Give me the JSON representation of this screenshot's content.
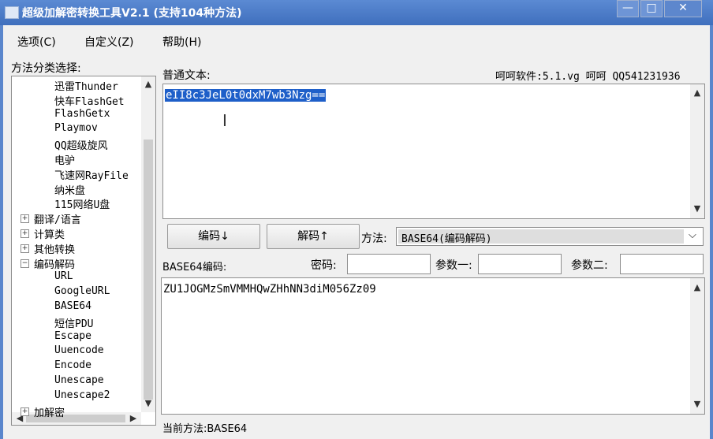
{
  "window": {
    "title": "超级加解密转换工具V2.1 (支持104种方法)",
    "minimize_glyph": "—",
    "maximize_glyph": "□",
    "close_glyph": "✕"
  },
  "menu": [
    "选项(C)",
    "自定义(Z)",
    "帮助(H)"
  ],
  "tree": {
    "label": "方法分类选择:",
    "items": [
      {
        "text": "迅雷Thunder",
        "level": 2
      },
      {
        "text": "快车FlashGet",
        "level": 2
      },
      {
        "text": "FlashGetx",
        "level": 2
      },
      {
        "text": "Playmov",
        "level": 2
      },
      {
        "text": "QQ超级旋风",
        "level": 2
      },
      {
        "text": "电驴",
        "level": 2
      },
      {
        "text": "飞速网RayFile",
        "level": 2
      },
      {
        "text": "纳米盘",
        "level": 2
      },
      {
        "text": "115网络U盘",
        "level": 2
      },
      {
        "text": "翻译/语言",
        "level": 1,
        "toggle": "+"
      },
      {
        "text": "计算类",
        "level": 1,
        "toggle": "+"
      },
      {
        "text": "其他转换",
        "level": 1,
        "toggle": "+"
      },
      {
        "text": "编码解码",
        "level": 1,
        "toggle": "−"
      },
      {
        "text": "URL",
        "level": 2
      },
      {
        "text": "GoogleURL",
        "level": 2
      },
      {
        "text": "BASE64",
        "level": 2
      },
      {
        "text": "短信PDU",
        "level": 2
      },
      {
        "text": "Escape",
        "level": 2
      },
      {
        "text": "Uuencode",
        "level": 2
      },
      {
        "text": "Encode",
        "level": 2
      },
      {
        "text": "Unescape",
        "level": 2
      },
      {
        "text": "Unescape2",
        "level": 2
      },
      {
        "text": "加解密",
        "level": 1,
        "toggle": "+"
      }
    ]
  },
  "plain": {
    "label": "普通文本:",
    "credit": "呵呵软件:5.1.vg  呵呵 QQ541231936",
    "value": "eII8c3JeL0t0dxM7wb3Nzg=="
  },
  "encode_button": "编码↓",
  "decode_button": "解码↑",
  "method": {
    "label": "方法:",
    "value": "BASE64(编码解码)"
  },
  "encoded": {
    "label": "BASE64编码:",
    "value": "ZU1JOGMzSmVMMHQwZHhNN3diM056Zz09"
  },
  "password": {
    "label": "密码:",
    "value": ""
  },
  "param1": {
    "label": "参数一:",
    "value": ""
  },
  "param2": {
    "label": "参数二:",
    "value": ""
  },
  "status": "当前方法:BASE64",
  "accent": "#4a7bc8",
  "selection_color": "#1e5fc9"
}
